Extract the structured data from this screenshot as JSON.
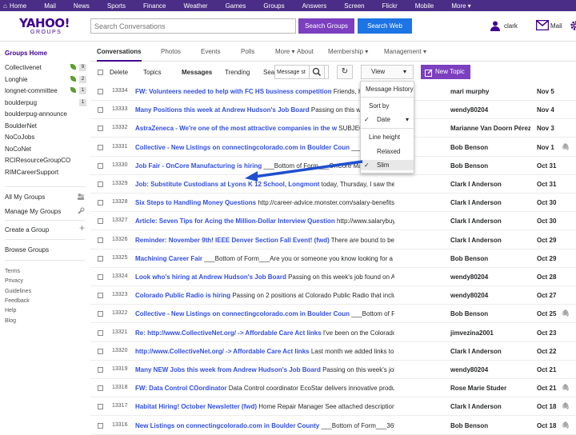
{
  "topbar": {
    "items": [
      "Home",
      "Mail",
      "News",
      "Sports",
      "Finance",
      "Weather",
      "Games",
      "Groups",
      "Answers",
      "Screen",
      "Flickr",
      "Mobile",
      "More"
    ]
  },
  "header": {
    "logo_main": "YAHOO!",
    "logo_sub": "GROUPS",
    "search_placeholder": "Search Conversations",
    "search_groups_label": "Search Groups",
    "search_web_label": "Search Web",
    "user_name": "clark",
    "mail_label": "Mail"
  },
  "sidebar": {
    "groups_home": "Groups Home",
    "groups": [
      {
        "name": "Collectivenet",
        "badge": "9",
        "leaf": true
      },
      {
        "name": "Longhie",
        "badge": "2",
        "leaf": true
      },
      {
        "name": "longnet-committee",
        "badge": "1",
        "leaf": true
      },
      {
        "name": "boulderpug",
        "badge": "1",
        "leaf": false
      },
      {
        "name": "boulderpug-announce",
        "badge": "",
        "leaf": false
      },
      {
        "name": "BoulderNet",
        "badge": "",
        "leaf": false
      },
      {
        "name": "NoCoJobs",
        "badge": "",
        "leaf": false
      },
      {
        "name": "NoCoNet",
        "badge": "",
        "leaf": false
      },
      {
        "name": "RCIResourceGroupCO",
        "badge": "",
        "leaf": false
      },
      {
        "name": "RIMCareerSupport",
        "badge": "",
        "leaf": false
      }
    ],
    "all_my_groups": "All My Groups",
    "manage_my_groups": "Manage My Groups",
    "create_group": "Create a Group",
    "browse_groups": "Browse Groups",
    "footer_links": [
      "Terms",
      "Privacy",
      "Guidelines",
      "Feedback",
      "Help",
      "Blog"
    ]
  },
  "tabs": [
    "Conversations",
    "Photos",
    "Events",
    "Polls",
    "More",
    "About",
    "Membership",
    "Management"
  ],
  "toolbar": {
    "delete": "Delete",
    "topics": "Topics",
    "messages": "Messages",
    "trending": "Trending",
    "search_truncated": "Sea",
    "msg_search_value": "Message st",
    "view_label": "View",
    "new_topic_label": "New Topic"
  },
  "view_menu": {
    "title": "Message History",
    "sort_by": "Sort by",
    "date": "Date",
    "line_height": "Line height",
    "relaxed": "Relaxed",
    "slim": "Slim"
  },
  "messages": [
    {
      "num": "13334",
      "title": "FW: Volunteers needed to help with FC HS business competition",
      "snippet": " Friends, Here is a chance to help in this fu",
      "author": "mari murphy",
      "date": "Nov 5",
      "clip": false
    },
    {
      "num": "13333",
      "title": "Many Positions this week at Andrew Hudson's Job Board",
      "snippet": " Passing on this week's job found on Andrew",
      "author": "wendy80204",
      "date": "Nov 4",
      "clip": false
    },
    {
      "num": "13332",
      "title": "AstraZeneca - We're one of the most attractive companies in the w",
      "snippet": " SUBJECT: Opportunities at AstraZeneca. Fill out ou",
      "author": "Marianne Van Doorn Pérez",
      "date": "Nov 3",
      "clip": false
    },
    {
      "num": "13331",
      "title": "Collective - New Listings on connectingcolorado.com in Boulder Coun",
      "snippet": " ___Bottom of Form___365 New Job Listings",
      "author": "Bob Benson",
      "date": "Nov 1",
      "clip": true
    },
    {
      "num": "13330",
      "title": "Job Fair - OnCore Manufacturing is hiring",
      "snippet": " ___Bottom of Form___OnCore Manufacturing is OnCore",
      "author": "Bob Benson",
      "date": "Oct 31",
      "clip": false
    },
    {
      "num": "13329",
      "title": "Job: Substitute Custodians at Lyons K 12 School, Longmont",
      "snippet": " today, Thursday, I saw the sign on the fence",
      "author": "Clark I Anderson",
      "date": "Oct 31",
      "clip": false
    },
    {
      "num": "13328",
      "title": "Six Steps to Handling Money Questions",
      "snippet": " http://career-advice.monster.com/salary-benefits/negotiating-tips/six",
      "author": "Clark I Anderson",
      "date": "Oct 30",
      "clip": false
    },
    {
      "num": "13327",
      "title": "Article: Seven Tips for Acing the Million-Dollar Interview Question",
      "snippet": " http://www.salarybuy.com/careers/seven",
      "author": "Clark I Anderson",
      "date": "Oct 30",
      "clip": false
    },
    {
      "num": "13326",
      "title": "Reminder: November 9th! IEEE Denver Section Fall Event! (fwd)",
      "snippet": " There are bound to be some networking",
      "author": "Clark I Anderson",
      "date": "Oct 29",
      "clip": false
    },
    {
      "num": "13325",
      "title": "Machining Career Fair",
      "snippet": " ___Bottom of Form___Are you or someone you know looking for a career change? Come",
      "author": "Bob Benson",
      "date": "Oct 29",
      "clip": false
    },
    {
      "num": "13324",
      "title": "Look who's hiring at Andrew Hudson's Job Board",
      "snippet": " Passing on this week's job found on Andrew Hudson's Job",
      "author": "wendy80204",
      "date": "Oct 28",
      "clip": false
    },
    {
      "num": "13323",
      "title": "Colorado Public Radio is hiring",
      "snippet": " Passing on 2 positions at Colorado Public Radio that include a Arts Reporter",
      "author": "wendy80204",
      "date": "Oct 27",
      "clip": false
    },
    {
      "num": "13322",
      "title": "Collective - New Listings on connectingcolorado.com in Boulder Coun",
      "snippet": " ___Bottom of Form___349 New Job Listings",
      "author": "Bob Benson",
      "date": "Oct 25",
      "clip": true
    },
    {
      "num": "13321",
      "title": "Re: http://www.CollectiveNet.org/ -> Affordable Care Act links",
      "snippet": " I've been on the Colorado site (connectforhealthco",
      "author": "jimvezina2001",
      "date": "Oct 23",
      "clip": false
    },
    {
      "num": "13320",
      "title": "http://www.CollectiveNet.org/ -> Affordable Care Act links",
      "snippet": " Last month we added links to Affordable Care Act info",
      "author": "Clark I Anderson",
      "date": "Oct 22",
      "clip": false
    },
    {
      "num": "13319",
      "title": "Many NEW Jobs this week from Andrew Hudson's Job Board",
      "snippet": " Passing on this week's job found on Andrew",
      "author": "wendy80204",
      "date": "Oct 21",
      "clip": false
    },
    {
      "num": "13318",
      "title": "FW: Data Control COordinator",
      "snippet": " Data Control coordinator EcoStar delivers innovative products and services that",
      "author": "Rose Marie Studer",
      "date": "Oct 21",
      "clip": true
    },
    {
      "num": "13317",
      "title": "Habitat Hiring! October Newsletter (fwd)",
      "snippet": " Home Repair Manager See attached description. Clark Anderson",
      "author": "Clark I Anderson",
      "date": "Oct 18",
      "clip": true
    },
    {
      "num": "13316",
      "title": "New Listings on connectingcolorado.com in Boulder County",
      "snippet": " ___Bottom of Form___365 New Job Listings",
      "author": "Bob Benson",
      "date": "Oct 18",
      "clip": true
    }
  ],
  "colors": {
    "brand_purple": "#400090",
    "topbar": "#4a2d86",
    "button_purple": "#7c3fc0",
    "button_blue": "#1d74e5",
    "link_blue": "#324fe1",
    "arrow_blue": "#1f4fcf"
  }
}
